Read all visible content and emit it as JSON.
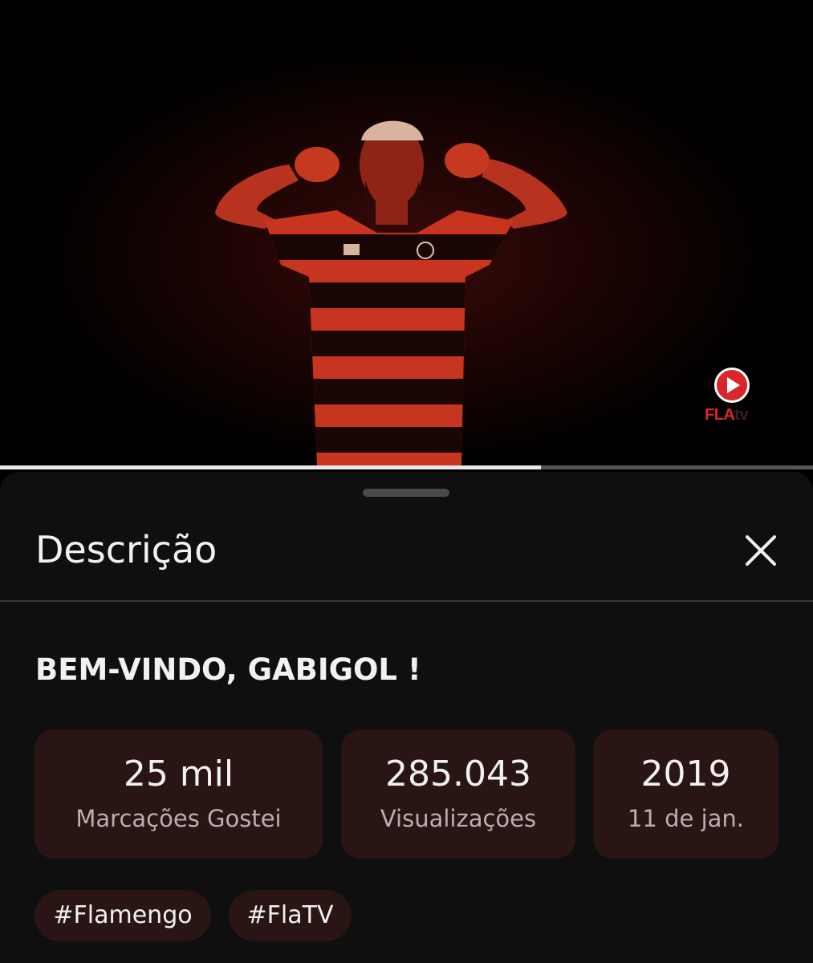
{
  "video": {
    "progress_fraction": 0.665,
    "logo_text_main": "FLA",
    "logo_text_suffix": "tv"
  },
  "sheet": {
    "title": "Descrição",
    "close_icon": "close-icon"
  },
  "description": {
    "video_title": "BEM-VINDO, GABIGOL !",
    "stats": [
      {
        "value": "25 mil",
        "label": "Marcações Gostei"
      },
      {
        "value": "285.043",
        "label": "Visualizações"
      },
      {
        "value": "2019",
        "label": "11 de jan."
      }
    ],
    "hashtags": [
      "#Flamengo",
      "#FlaTV"
    ]
  },
  "colors": {
    "sheet_background": "#0f0f0f",
    "chip_background": "#2a1515",
    "accent_red": "#d9262c"
  }
}
